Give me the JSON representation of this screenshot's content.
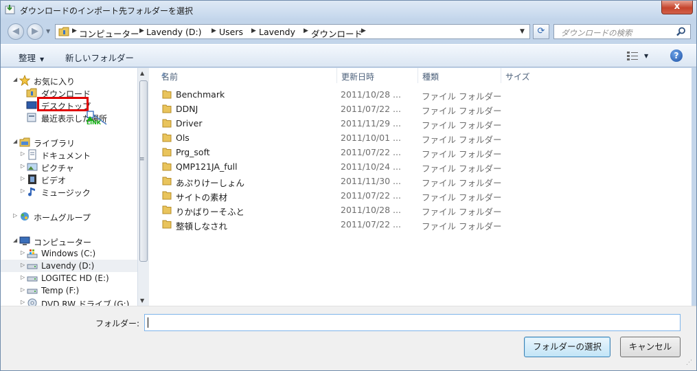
{
  "window": {
    "title": "ダウンロードのインポート先フォルダーを選択",
    "close": "x"
  },
  "address": {
    "crumbs": [
      "コンピューター",
      "Lavendy (D:)",
      "Users",
      "Lavendy",
      "ダウンロード"
    ],
    "search_placeholder": "ダウンロードの検索"
  },
  "toolbar": {
    "organize": "整理",
    "new_folder": "新しいフォルダー",
    "help": "?"
  },
  "nav": {
    "favorites": "お気に入り",
    "fav_downloads": "ダウンロード",
    "fav_desktop": "デスクトップ",
    "fav_recent": "最近表示した場所",
    "link_overlay": "LINK",
    "libraries": "ライブラリ",
    "lib_documents": "ドキュメント",
    "lib_pictures": "ピクチャ",
    "lib_videos": "ビデオ",
    "lib_music": "ミュージック",
    "homegroup": "ホームグループ",
    "computer": "コンピューター",
    "drive_c": "Windows (C:)",
    "drive_d": "Lavendy (D:)",
    "drive_e": "LOGITEC HD (E:)",
    "drive_f": "Temp (F:)",
    "drive_g": "DVD RW ドライブ (G:)"
  },
  "columns": {
    "name": "名前",
    "modified": "更新日時",
    "type": "種類",
    "size": "サイズ"
  },
  "files": [
    {
      "name": "Benchmark",
      "modified": "2011/10/28 ...",
      "type": "ファイル フォルダー"
    },
    {
      "name": "DDNJ",
      "modified": "2011/07/22 ...",
      "type": "ファイル フォルダー"
    },
    {
      "name": "Driver",
      "modified": "2011/11/29 ...",
      "type": "ファイル フォルダー"
    },
    {
      "name": "Ols",
      "modified": "2011/10/01 ...",
      "type": "ファイル フォルダー"
    },
    {
      "name": "Prg_soft",
      "modified": "2011/07/22 ...",
      "type": "ファイル フォルダー"
    },
    {
      "name": "QMP121JA_full",
      "modified": "2011/10/24 ...",
      "type": "ファイル フォルダー"
    },
    {
      "name": "あぷりけーしょん",
      "modified": "2011/11/30 ...",
      "type": "ファイル フォルダー"
    },
    {
      "name": "サイトの素材",
      "modified": "2011/07/22 ...",
      "type": "ファイル フォルダー"
    },
    {
      "name": "りかばりーそふと",
      "modified": "2011/10/28 ...",
      "type": "ファイル フォルダー"
    },
    {
      "name": "整頓しなされ",
      "modified": "2011/07/22 ...",
      "type": "ファイル フォルダー"
    }
  ],
  "footer": {
    "folder_label": "フォルダー:",
    "folder_value": "",
    "select_button": "フォルダーの選択",
    "cancel_button": "キャンセル"
  },
  "colors": {
    "highlight_box": "#e00000",
    "selected_button_border": "#3c7fb1",
    "link_overlay": "#16b216"
  }
}
